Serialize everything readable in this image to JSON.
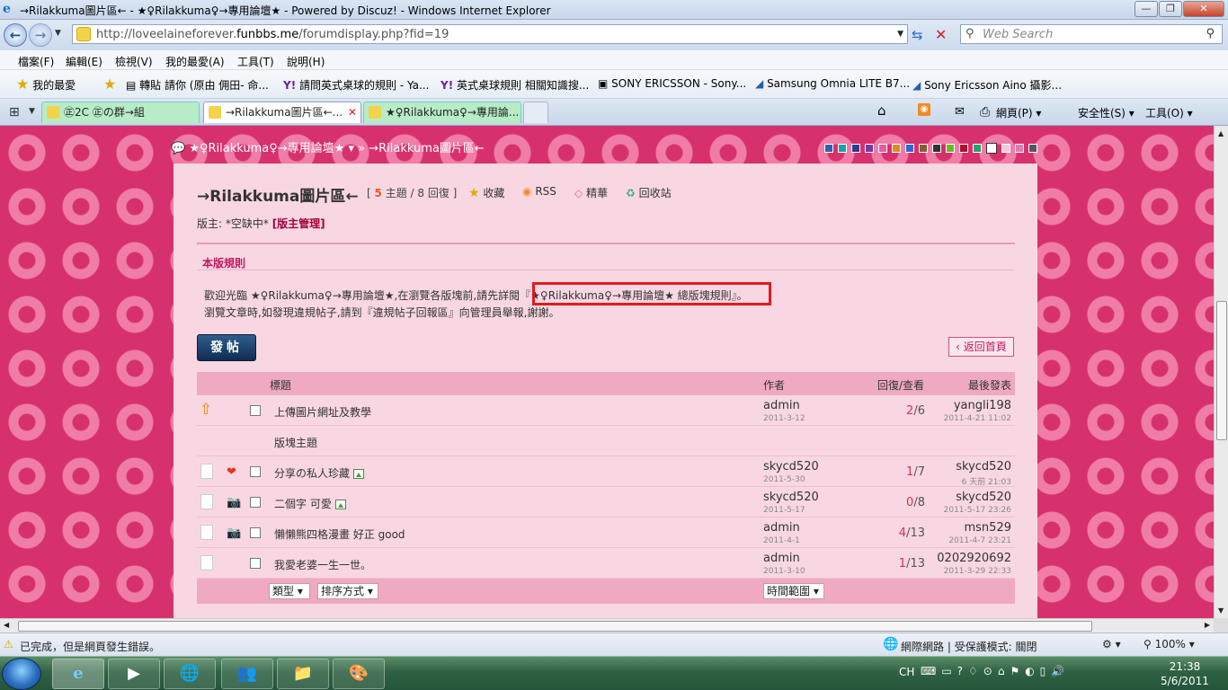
{
  "window": {
    "title": "→Rilakkuma圖片區← - ★♀Rilakkuma♀→專用論壇★ - Powered by Discuz! - Windows Internet Explorer"
  },
  "address": {
    "url_prefix": "http://loveelaineforever.",
    "url_domain": "funbbs.me",
    "url_suffix": "/forumdisplay.php?fid=19",
    "search_placeholder": "Web Search"
  },
  "menu": [
    "檔案(F)",
    "編輯(E)",
    "檢視(V)",
    "我的最愛(A)",
    "工具(T)",
    "說明(H)"
  ],
  "favorites": {
    "label": "我的最愛",
    "items": [
      "轉貼 請你 (原由 佣田- 命...",
      "請問英式桌球的規則 - Ya...",
      "英式桌球規則 相關知識搜...",
      "SONY ERICSSON - Sony...",
      "Samsung Omnia LITE B7...",
      "Sony Ericsson Aino 攝影..."
    ]
  },
  "tabs": [
    {
      "label": "㊣2C ㊣の群→組"
    },
    {
      "label": "→Rilakkuma圖片區←..."
    },
    {
      "label": "★♀Rilakkuma♀→專用論..."
    }
  ],
  "commands": {
    "page": "網頁(P)",
    "safety": "安全性(S)",
    "tools": "工具(O)"
  },
  "forum": {
    "breadcrumb_home": "★♀Rilakkuma♀→專用論壇★",
    "breadcrumb_sep": "»",
    "breadcrumb_current": "→Rilakkuma圖片區←",
    "title": "→Rilakkuma圖片區←",
    "stats_open": "[",
    "topics_count": "5",
    "topics_text": "主題 / 8 回復",
    "stats_close": "]",
    "tools": [
      "收藏",
      "RSS",
      "精華",
      "回收站"
    ],
    "moderator_label": "版主: *空缺中*",
    "moderator_manage": "[版主管理]",
    "rules_heading": "本版規則",
    "rule_line1_a": "歡迎光臨 ★♀Rilakkuma♀→專用論壇★,在瀏覽各版塊前,請先詳閱",
    "rule_line1_link": "『★♀Rilakkuma♀→專用論壇★ 總版塊規則』",
    "rule_line1_b": "。",
    "rule_line2": "瀏覽文章時,如發現違規帖子,請到『違規帖子回報區』向管理員舉報,謝謝。",
    "post_button": "發帖",
    "back_button": "返回首頁",
    "columns": {
      "title": "標題",
      "author": "作者",
      "replies_views": "回復/查看",
      "last_post": "最後發表"
    },
    "section_label": "版塊主題",
    "threads": [
      {
        "title": "上傳圖片網址及教學",
        "author": "admin",
        "date": "2011-3-12",
        "replies": "2",
        "views": "6",
        "last_user": "yangli198",
        "last_date": "2011-4-21 11:02",
        "pinned": true,
        "has_image": false
      },
      {
        "title": "分享の私人珍藏",
        "author": "skycd520",
        "date": "2011-5-30",
        "replies": "1",
        "views": "7",
        "last_user": "skycd520",
        "last_date": "6 天前 21:03",
        "has_image": true,
        "type_icon": "heart"
      },
      {
        "title": "二個字 可愛",
        "author": "skycd520",
        "date": "2011-5-17",
        "replies": "0",
        "views": "8",
        "last_user": "skycd520",
        "last_date": "2011-5-17 23:26",
        "has_image": true,
        "type_icon": "camera"
      },
      {
        "title": "懶懶熊四格漫畫 好正 good",
        "author": "admin",
        "date": "2011-4-1",
        "replies": "4",
        "views": "13",
        "last_user": "msn529",
        "last_date": "2011-4-7 23:21",
        "has_image": false,
        "type_icon": "camera"
      },
      {
        "title": "我愛老婆一生一世。",
        "author": "admin",
        "date": "2011-3-10",
        "replies": "1",
        "views": "13",
        "last_user": "0202920692",
        "last_date": "2011-3-29 22:33",
        "has_image": false,
        "type_icon": ""
      }
    ],
    "filters": {
      "type": "類型",
      "sort": "排序方式",
      "time": "時間範圍"
    }
  },
  "status": {
    "text": "已完成，但是網頁發生錯誤。",
    "zone": "網際網路 | 受保護模式: 關閉",
    "zoom": "100%"
  },
  "taskbar": {
    "lang": "CH",
    "time": "21:38",
    "date": "5/6/2011"
  },
  "colors": {
    "accent": "#d6316e",
    "highlight_border": "#e01b1b",
    "reply_count": "#d8304f"
  }
}
